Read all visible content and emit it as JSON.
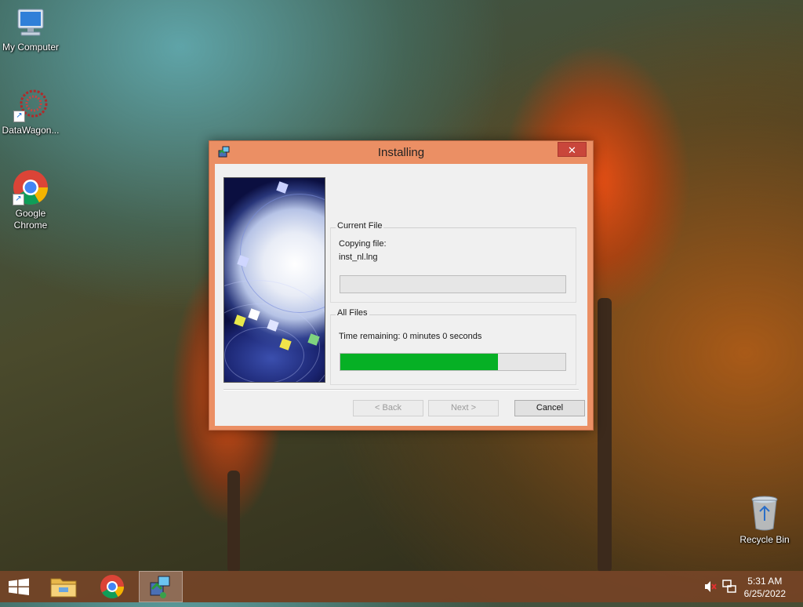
{
  "desktop": {
    "icons": [
      {
        "label": "My Computer",
        "icon": "my-computer-icon"
      },
      {
        "label": "DataWagon...",
        "icon": "datawagon-icon"
      },
      {
        "label": "Google Chrome",
        "icon": "chrome-icon"
      },
      {
        "label": "Recycle Bin",
        "icon": "recycle-bin-icon"
      }
    ]
  },
  "dialog": {
    "title": "Installing",
    "close_label": "✕",
    "current_file": {
      "group_label": "Current File",
      "action": "Copying file:",
      "filename": "inst_nl.lng",
      "progress": 0
    },
    "all_files": {
      "group_label": "All Files",
      "time_remaining": "Time remaining: 0 minutes 0 seconds",
      "progress": 0.7
    },
    "buttons": {
      "back": "< Back",
      "next": "Next >",
      "cancel": "Cancel"
    },
    "colors": {
      "frame": "#eb8f64",
      "progress_fill": "#06b025",
      "close_button": "#c9463b"
    }
  },
  "taskbar": {
    "items": [
      "start-icon",
      "file-explorer-icon",
      "chrome-icon",
      "installer-icon"
    ],
    "tray": [
      "volume-muted-icon",
      "network-icon"
    ],
    "clock": {
      "time": "5:31 AM",
      "date": "6/25/2022"
    }
  }
}
